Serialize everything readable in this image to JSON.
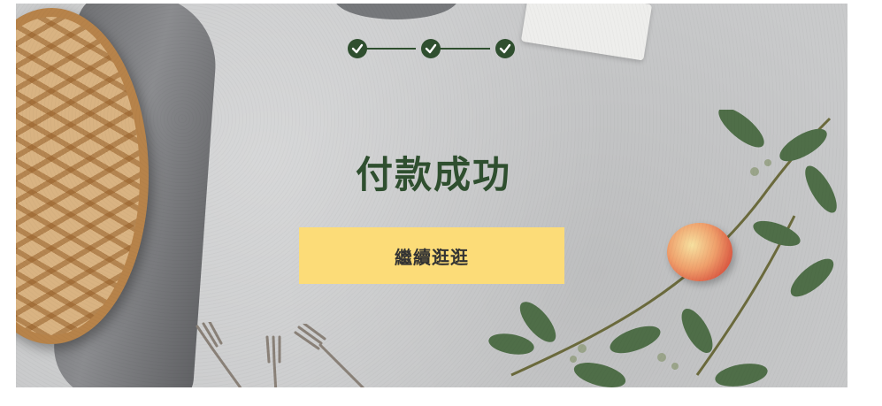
{
  "page": {
    "title": "付款成功",
    "continue_button": "繼續逛逛"
  },
  "stepper": {
    "steps": [
      "completed",
      "completed",
      "completed"
    ],
    "icon": "check-icon"
  },
  "colors": {
    "accent": "#2f4f2f",
    "button_bg": "#fcdc78",
    "background": "#c9cacb"
  }
}
